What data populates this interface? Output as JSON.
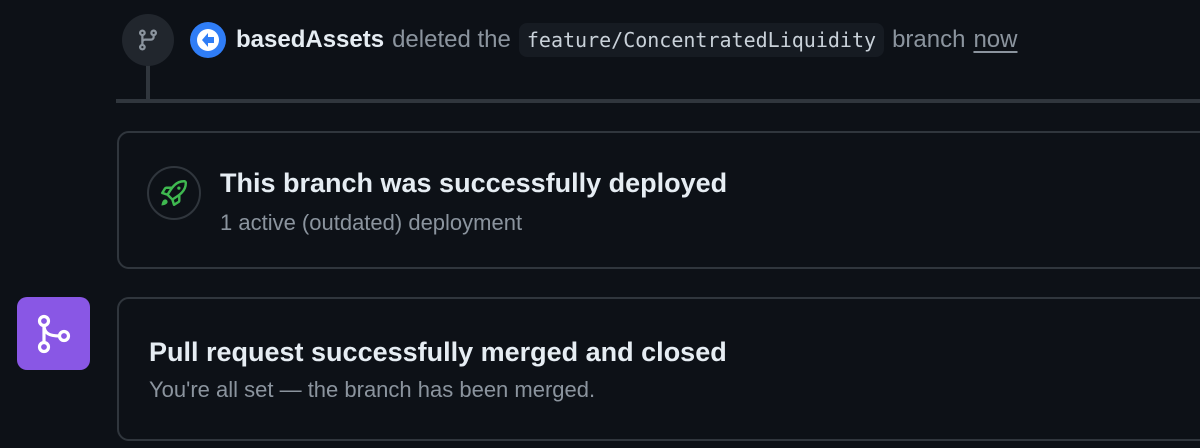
{
  "event": {
    "icon": "git-branch-icon",
    "actor": "basedAssets",
    "action_text": "deleted the",
    "branch_name": "feature/ConcentratedLiquidity",
    "suffix_text": "branch",
    "time_link": "now"
  },
  "deployment": {
    "icon": "rocket-icon",
    "title": "This branch was successfully deployed",
    "subtitle": "1 active (outdated) deployment"
  },
  "merge_status": {
    "icon": "git-merge-icon",
    "title": "Pull request successfully merged and closed",
    "subtitle": "You're all set — the branch has been merged."
  },
  "colors": {
    "background": "#0d1117",
    "border": "#30363d",
    "merged_purple": "#8957e5",
    "success_green": "#3fb950",
    "avatar_blue": "#2f7df6",
    "muted_text": "#8b949e"
  }
}
